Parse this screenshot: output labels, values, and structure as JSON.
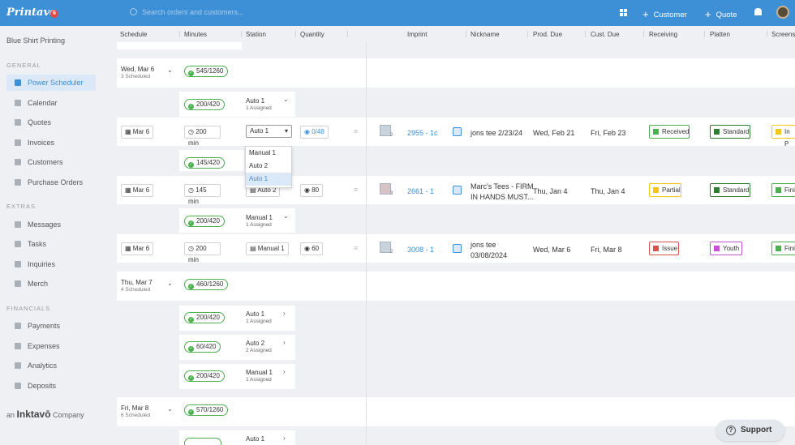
{
  "topbar": {
    "logo": "Printavo",
    "badge": "6",
    "search_placeholder": "Search orders and customers...",
    "customer_btn": "Customer",
    "quote_btn": "Quote"
  },
  "sidebar": {
    "org": "Blue Shirt Printing",
    "general": "GENERAL",
    "extras": "EXTRAS",
    "financials": "FINANCIALS",
    "items": [
      "Power Scheduler",
      "Calendar",
      "Quotes",
      "Invoices",
      "Customers",
      "Purchase Orders",
      "Messages",
      "Tasks",
      "Inquiries",
      "Merch",
      "Payments",
      "Expenses",
      "Analytics",
      "Deposits"
    ],
    "footer_prefix": "an",
    "footer_brand": "Inktavō",
    "footer_suffix": "Company"
  },
  "headers": [
    "Schedule",
    "Minutes",
    "Station",
    "Quantity",
    "Imprint",
    "Nickname",
    "Prod. Due",
    "Cust. Due",
    "Receiving",
    "Platten",
    "Screens"
  ],
  "days": [
    {
      "label": "Wed, Mar 6",
      "sub": "3 Scheduled",
      "cap": "545/1260"
    },
    {
      "label": "Thu, Mar 7",
      "sub": "4 Scheduled",
      "cap": "460/1260"
    },
    {
      "label": "Fri, Mar 8",
      "sub": "6 Scheduled",
      "cap": "570/1260"
    }
  ],
  "groups": [
    {
      "cap": "200/420",
      "station": "Auto 1",
      "assigned": "1 Assigned"
    },
    {
      "cap": "145/420",
      "station": "",
      "assigned": ""
    },
    {
      "cap": "200/420",
      "station": "Manual 1",
      "assigned": "1 Assigned"
    },
    {
      "cap": "200/420",
      "station": "Auto 1",
      "assigned": "1 Assigned"
    },
    {
      "cap": "60/420",
      "station": "Auto 2",
      "assigned": "2 Assigned"
    },
    {
      "cap": "200/420",
      "station": "Manual 1",
      "assigned": "1 Assigned"
    },
    {
      "cap": "",
      "station": "Auto 1",
      "assigned": ""
    }
  ],
  "jobs": [
    {
      "date": "Mar 6",
      "minutes": "200 min",
      "station": "Auto 1",
      "qty": "0/48",
      "thumb_count": "2",
      "imprint": "2955 - 1c",
      "nick": "jons tee 2/23/24",
      "nick2": "",
      "prod": "Wed, Feb 21",
      "cust": "Fri, Feb 23",
      "receiving": "Received",
      "platten": "Standard",
      "screens": "In P"
    },
    {
      "date": "Mar 6",
      "minutes": "145 min",
      "station": "Auto 2",
      "qty": "80",
      "thumb_count": "3",
      "imprint": "2661 - 1",
      "nick": "Marc's Tees - FIRM",
      "nick2": "IN HANDS MUST...",
      "prod": "Thu, Jan 4",
      "cust": "Thu, Jan 4",
      "receiving": "Partial",
      "platten": "Standard",
      "screens": "Fini"
    },
    {
      "date": "Mar 6",
      "minutes": "200 min",
      "station": "Manual 1",
      "qty": "60",
      "thumb_count": "2",
      "imprint": "3008 - 1",
      "nick": "jons tee",
      "nick2": "03/08/2024",
      "prod": "Wed, Mar 6",
      "cust": "Fri, Mar 8",
      "receiving": "Issue",
      "platten": "Youth",
      "screens": "Fini"
    }
  ],
  "dropdown": [
    "Manual 1",
    "Auto 2",
    "Auto 1"
  ],
  "support": "Support",
  "colors": {
    "accent": "#3d8fd6",
    "green": "#4caf50",
    "received": "#4caf50",
    "partial": "#f5c518",
    "issue": "#d9534f",
    "standard": "#2e7d32",
    "youth": "#c94fd6"
  }
}
